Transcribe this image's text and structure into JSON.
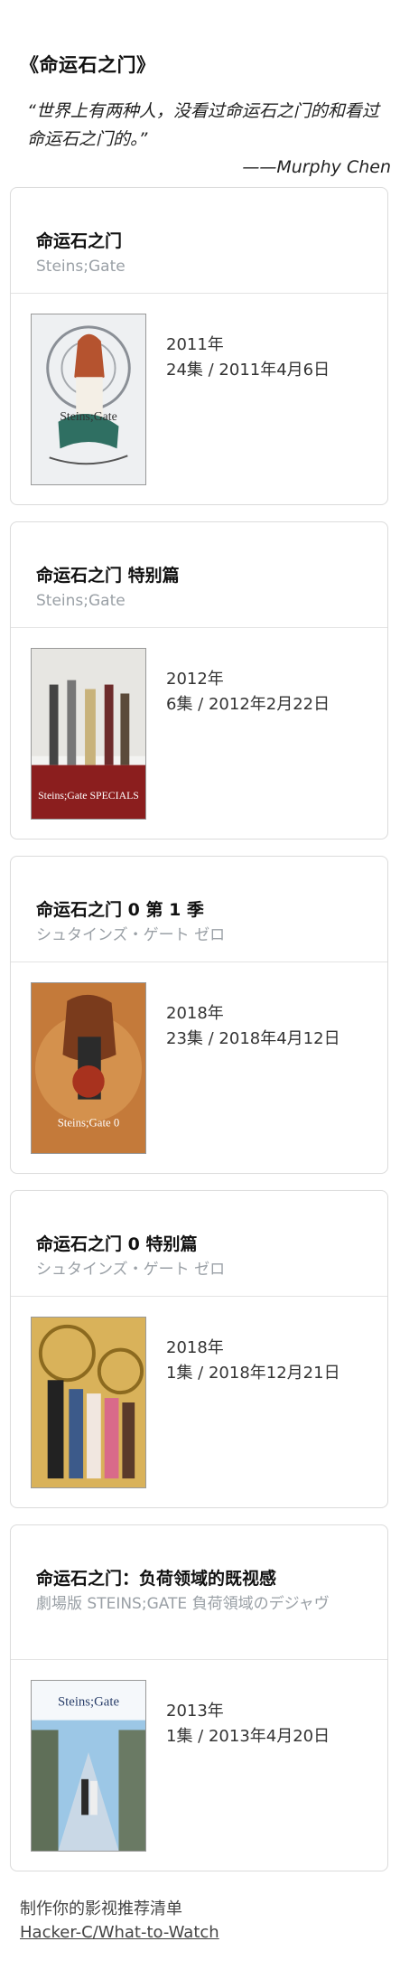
{
  "page": {
    "title": "《命运石之门》",
    "quote": "“世界上有两种人，没看过命运石之门的和看过命运石之门的。”",
    "author": "——Murphy Chen"
  },
  "cards": [
    {
      "title": "命运石之门",
      "subtitle": "Steins;Gate",
      "year": "2011年",
      "episodes": "24集 / 2011年4月6日",
      "poster_label": "Steins;Gate"
    },
    {
      "title": "命运石之门 特别篇",
      "subtitle": "Steins;Gate",
      "year": "2012年",
      "episodes": "6集 / 2012年2月22日",
      "poster_label": "Steins;Gate SPECIALS"
    },
    {
      "title": "命运石之门 0 第 1 季",
      "subtitle": "シュタインズ・ゲート ゼロ",
      "year": "2018年",
      "episodes": "23集 / 2018年4月12日",
      "poster_label": "Steins;Gate 0"
    },
    {
      "title": "命运石之门 0 特别篇",
      "subtitle": "シュタインズ・ゲート ゼロ",
      "year": "2018年",
      "episodes": "1集 / 2018年12月21日",
      "poster_label": ""
    },
    {
      "title": "命运石之门：负荷领域的既视感",
      "subtitle": "劇場版 STEINS;GATE 負荷領域のデジャヴ",
      "year": "2013年",
      "episodes": "1集 / 2013年4月20日",
      "poster_label": "Steins;Gate"
    }
  ],
  "footer": {
    "text": "制作你的影视推荐清单",
    "link": "Hacker-C/What-to-Watch"
  }
}
